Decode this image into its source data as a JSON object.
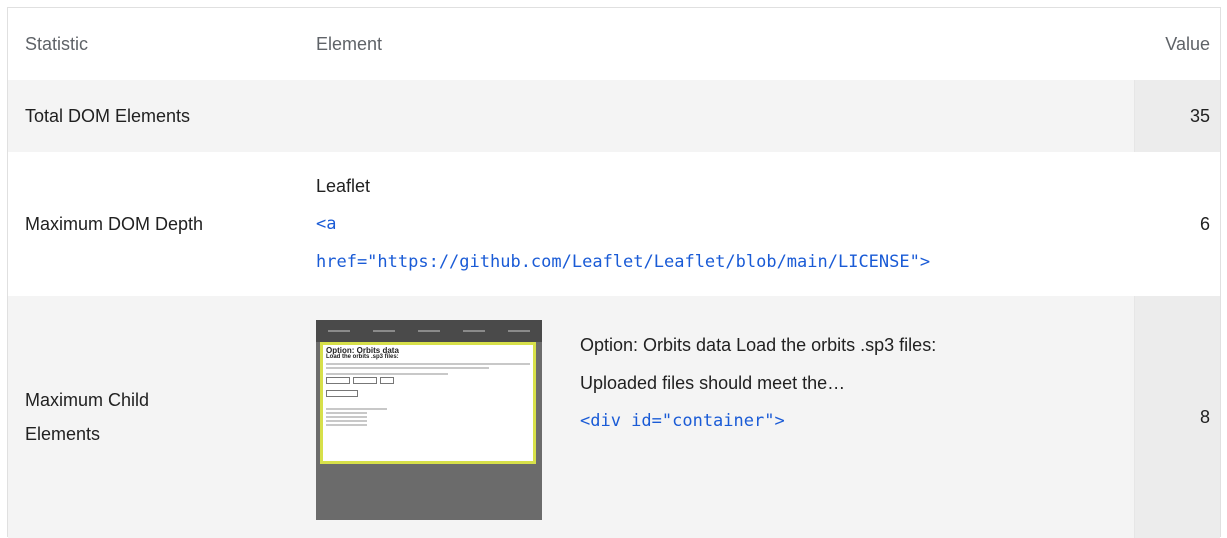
{
  "table": {
    "headers": {
      "statistic": "Statistic",
      "element": "Element",
      "value": "Value"
    },
    "rows": [
      {
        "statistic": "Total DOM Elements",
        "value": "35"
      },
      {
        "statistic": "Maximum DOM Depth",
        "element_text": "Leaflet",
        "element_code_1": "<a",
        "element_code_2": "href=\"https://github.com/Leaflet/Leaflet/blob/main/LICENSE\">",
        "value": "6"
      },
      {
        "statistic_line1": "Maximum Child",
        "statistic_line2": "Elements",
        "element_desc_1": "Option: Orbits data Load the orbits .sp3 files:",
        "element_desc_2": "Uploaded files should meet the…",
        "element_code": "<div id=\"container\">",
        "value": "8"
      }
    ]
  },
  "thumbnail": {
    "title": "Option: Orbits data",
    "subtitle": "Load the orbits .sp3 files:"
  }
}
